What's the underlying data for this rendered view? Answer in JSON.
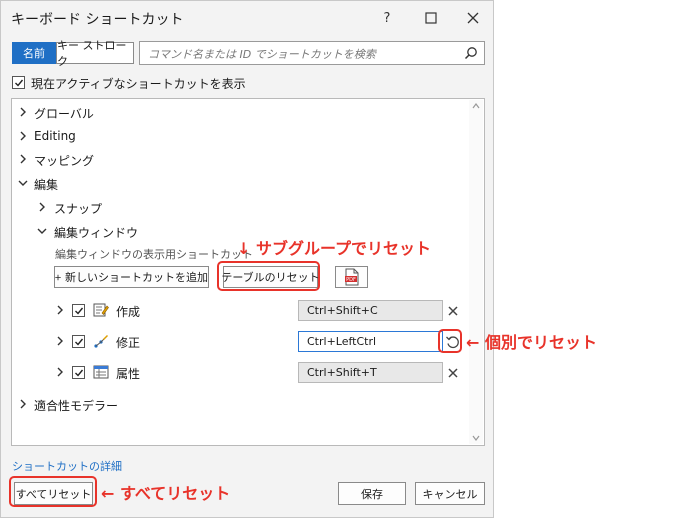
{
  "dialog": {
    "title": "キーボード ショートカット",
    "help_label": "?"
  },
  "toolbar": {
    "name_toggle": "名前",
    "keystroke_toggle": "キー ストローク",
    "search_placeholder": "コマンド名または ID でショートカットを検索"
  },
  "filter": {
    "active_only_label": "現在アクティブなショートカットを表示",
    "active_only_checked": true
  },
  "tree": {
    "groups": [
      {
        "label": "グローバル",
        "expanded": false
      },
      {
        "label": "Editing",
        "expanded": false
      },
      {
        "label": "マッピング",
        "expanded": false
      },
      {
        "label": "編集",
        "expanded": true
      },
      {
        "label": "適合性モデラー",
        "expanded": false
      }
    ],
    "subgroups": [
      {
        "label": "スナップ",
        "expanded": false
      },
      {
        "label": "編集ウィンドウ",
        "expanded": true
      }
    ],
    "table_caption": "編集ウィンドウの表示用ショートカット",
    "add_shortcut_label": "新しいショートカットを追加",
    "reset_table_label": "テーブルのリセット",
    "export_pdf_icon": "pdf-icon",
    "rows": [
      {
        "label": "作成",
        "shortcut": "Ctrl+Shift+C",
        "icon": "create-icon",
        "checked": true,
        "action": "remove"
      },
      {
        "label": "修正",
        "shortcut": "Ctrl+LeftCtrl",
        "icon": "modify-icon",
        "checked": true,
        "action": "reset"
      },
      {
        "label": "属性",
        "shortcut": "Ctrl+Shift+T",
        "icon": "attributes-icon",
        "checked": true,
        "action": "remove"
      }
    ]
  },
  "footer": {
    "details_label": "ショートカットの詳細",
    "reset_all_label": "すべてリセット",
    "save_label": "保存",
    "cancel_label": "キャンセル"
  },
  "annotations": {
    "subgroup_reset": "↓ サブグループでリセット",
    "individual_reset": "← 個別でリセット",
    "reset_all": "← すべてリセット",
    "color": "#e8332a"
  },
  "colors": {
    "accent": "#1f6fc5",
    "focus": "#2b78d6"
  }
}
